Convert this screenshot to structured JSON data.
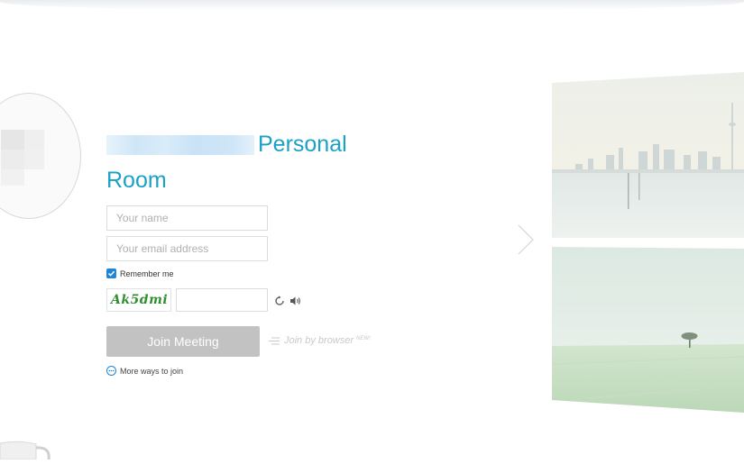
{
  "room": {
    "title_suffix": "Personal",
    "title_line2": "Room"
  },
  "form": {
    "name_placeholder": "Your name",
    "email_placeholder": "Your email address",
    "remember_label": "Remember me",
    "remember_checked": true,
    "captcha_text": "Ak5dmi",
    "captcha_input_value": "",
    "join_button": "Join Meeting",
    "join_browser": "Join by browser",
    "new_badge": "NEW!",
    "more_ways": "More ways to join"
  },
  "icons": {
    "refresh": "refresh-icon",
    "audio": "speaker-icon",
    "browser": "browser-lines-icon",
    "next": "chevron-right-icon",
    "more": "ellipsis-circle-icon"
  },
  "colors": {
    "accent": "#1ba0c7",
    "checkbox": "#1e86d9",
    "button_disabled": "#c2c2c2",
    "captcha": "#2f8f2f"
  }
}
